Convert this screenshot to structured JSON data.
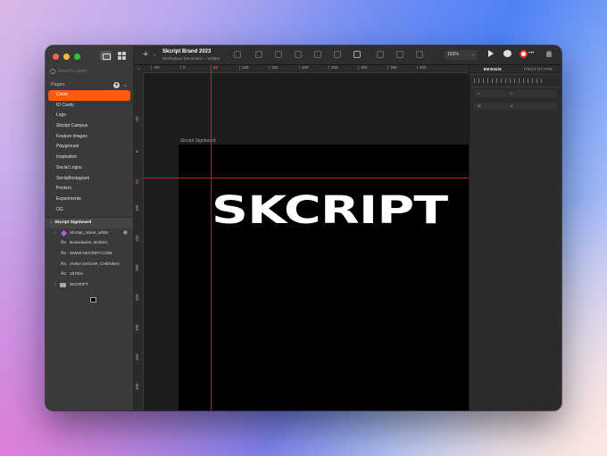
{
  "toolbar": {
    "doc_title": "Skcript Brand 2023",
    "doc_subtitle": "Workspace Document — Edited",
    "zoom": "153%"
  },
  "sidebar": {
    "search_placeholder": "Search Layers",
    "pages_label": "Pages",
    "pages": [
      {
        "label": "Cover",
        "active": true
      },
      {
        "label": "ID Cards"
      },
      {
        "label": "Logo"
      },
      {
        "label": "Skcript Campus"
      },
      {
        "label": "Feature images"
      },
      {
        "label": "Playground"
      },
      {
        "label": "Inspiration"
      },
      {
        "label": "Social Logos"
      },
      {
        "label": "Social/Instagram"
      },
      {
        "label": "Posters"
      },
      {
        "label": "Experiments"
      },
      {
        "label": "OG"
      }
    ],
    "layers": [
      {
        "label": "Skcript Signboard",
        "kind": "artboard"
      },
      {
        "label": "Skcript_name_white",
        "kind": "component"
      },
      {
        "label": "Boundaries. Broken.",
        "kind": "text"
      },
      {
        "label": "WWW.SKCRIPT.COM",
        "kind": "text"
      },
      {
        "label": "ANNA NAGAR, CHENNAI",
        "kind": "text"
      },
      {
        "label": "1578/A",
        "kind": "text"
      },
      {
        "label": "SKCRIPT",
        "kind": "group"
      }
    ]
  },
  "canvas": {
    "ruler_top": [
      "-50",
      "0",
      "50",
      "100",
      "150",
      "200",
      "250",
      "300",
      "350",
      "400"
    ],
    "ruler_top_highlight": "55",
    "ruler_left": [
      "-50",
      "0",
      "100",
      "150",
      "200",
      "250",
      "300",
      "350",
      "400"
    ],
    "ruler_left_highlight": "55",
    "artboard_label": "Skcript Signboard",
    "logo_text": "SKCRIPT"
  },
  "inspector": {
    "tabs": [
      "DESIGN",
      "PROTOTYPE"
    ],
    "fields": {
      "x": "X",
      "y": "Y",
      "w": "W",
      "h": "H"
    }
  },
  "colors": {
    "accent": "#ff5a0a",
    "guide": "#b3262a",
    "artboard": "#000000"
  }
}
